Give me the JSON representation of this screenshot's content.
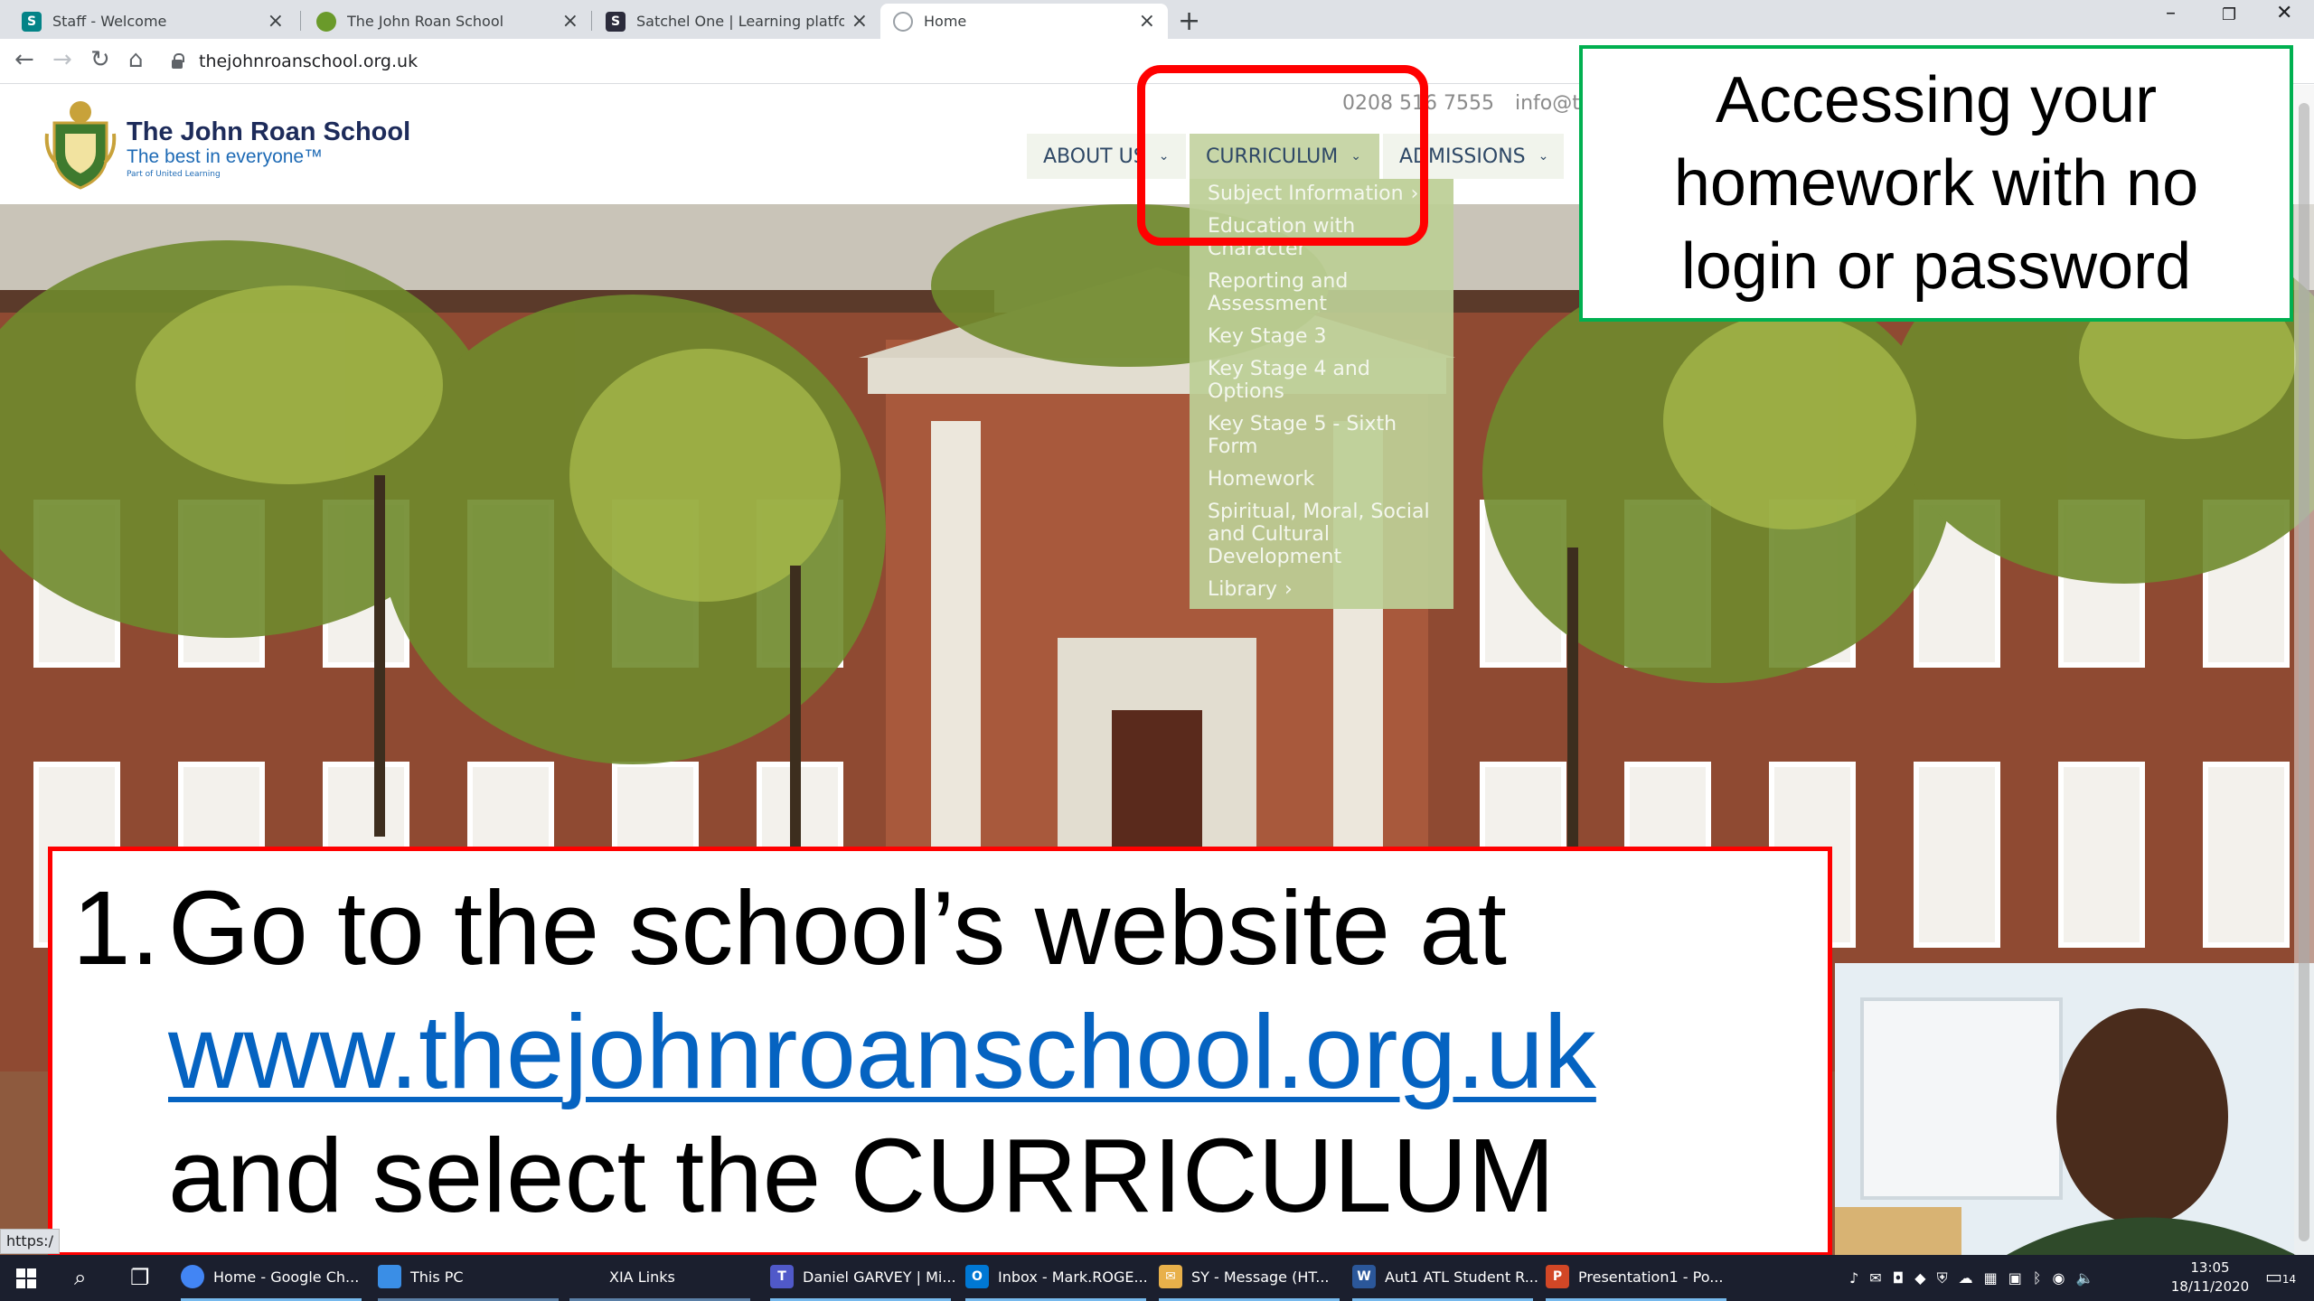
{
  "browser": {
    "tabs": [
      {
        "label": "Staff - Welcome",
        "favicon": "sharepoint-icon",
        "color": "#038387"
      },
      {
        "label": "The John Roan School",
        "favicon": "school-crest-icon",
        "color": "#6a9a2a"
      },
      {
        "label": "Satchel One | Learning platform",
        "favicon": "satchel-icon",
        "color": "#2b2b3b"
      },
      {
        "label": "Home",
        "favicon": "loading-globe-icon",
        "color": "#9aa0a6",
        "active": true
      }
    ],
    "close_glyph": "×",
    "new_tab_glyph": "+",
    "url": "thejohnroanschool.org.uk",
    "status_url": "https:/"
  },
  "site": {
    "name": "The John Roan School",
    "tagline": "The best in everyone™",
    "subtag": "Part of United Learning",
    "phone": "0208 516 7555",
    "email": "info@the",
    "nav": [
      {
        "label": "ABOUT US",
        "active": false
      },
      {
        "label": "CURRICULUM",
        "active": true
      },
      {
        "label": "ADMISSIONS",
        "active": false
      }
    ],
    "curriculum_menu": [
      {
        "label": "Subject Information",
        "arrow": true
      },
      {
        "label": "Education with Character",
        "arrow": false
      },
      {
        "label": "Reporting and Assessment",
        "arrow": false
      },
      {
        "label": "Key Stage 3",
        "arrow": false
      },
      {
        "label": "Key Stage 4 and Options",
        "arrow": false
      },
      {
        "label": "Key Stage 5 - Sixth Form",
        "arrow": false
      },
      {
        "label": "Homework",
        "arrow": false
      },
      {
        "label": "Spiritual, Moral, Social and Cultural Development",
        "arrow": false
      },
      {
        "label": "Library",
        "arrow": true
      }
    ]
  },
  "slide": {
    "title": "Accessing your homework with no login or password",
    "step_number": "1.",
    "step_text_before": "Go to the school’s website at",
    "step_link": "www.thejohnroanschool.org.uk",
    "step_text_after": "and select the CURRICULUM menu",
    "highlight_color": "#ff0000",
    "title_border_color": "#00b050"
  },
  "taskbar": {
    "apps": [
      {
        "label": "Home - Google Ch...",
        "icon": "chrome-icon",
        "color": "#4285f4"
      },
      {
        "label": "This PC",
        "icon": "this-pc-icon",
        "color": "#3a8ee6"
      },
      {
        "label": "XIA Links",
        "icon": "",
        "color": ""
      },
      {
        "label": "Daniel GARVEY | Mi...",
        "icon": "teams-icon",
        "color": "#5059c9"
      },
      {
        "label": "Inbox - Mark.ROGE...",
        "icon": "outlook-icon",
        "color": "#0078d4"
      },
      {
        "label": "SY - Message (HT...",
        "icon": "mail-envelope-icon",
        "color": "#e8b04a"
      },
      {
        "label": "Aut1 ATL Student R...",
        "icon": "word-icon",
        "color": "#2b579a"
      },
      {
        "label": "Presentation1 - Po...",
        "icon": "powerpoint-icon",
        "color": "#d24726"
      }
    ],
    "time": "13:05",
    "date": "18/11/2020",
    "notification_count": "14"
  }
}
